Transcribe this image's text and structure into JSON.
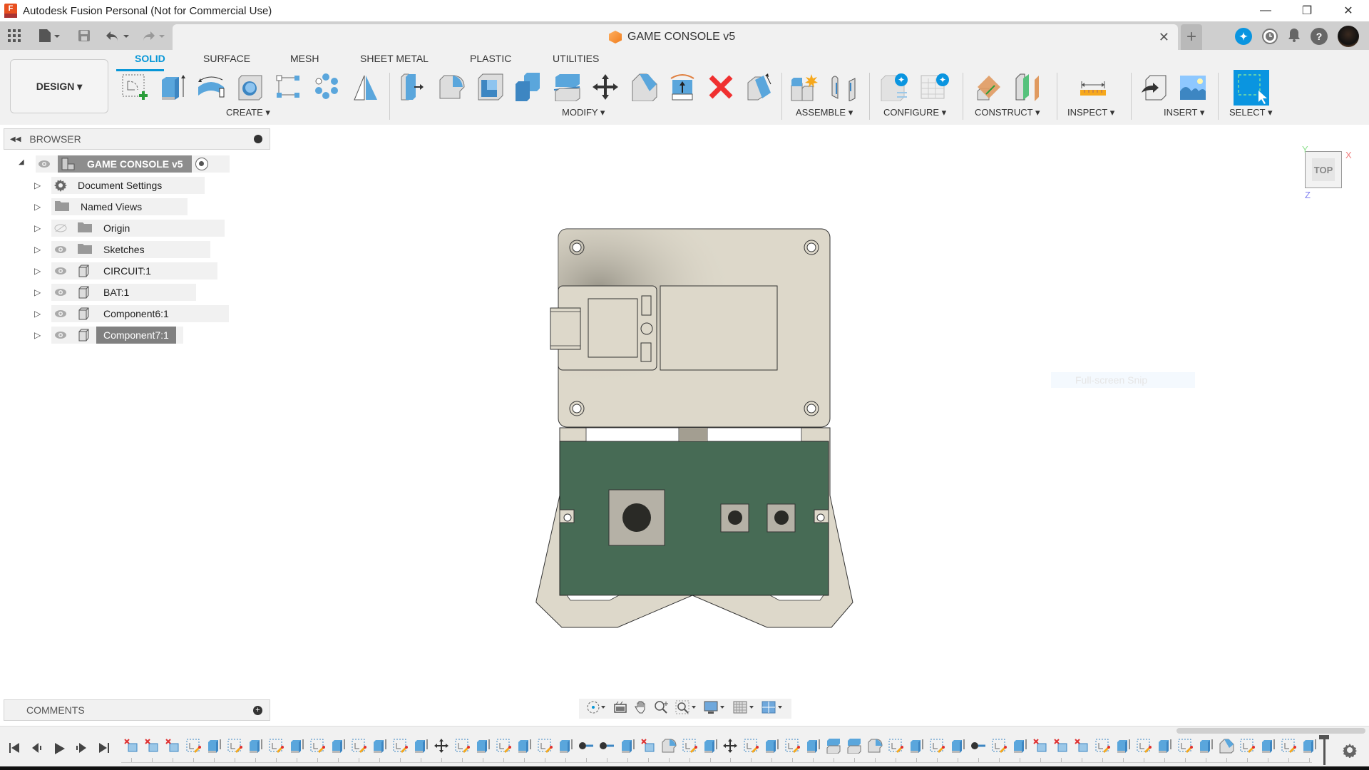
{
  "window": {
    "title": "Autodesk Fusion Personal (Not for Commercial Use)",
    "logo_letter": "F",
    "controls": {
      "minimize": "—",
      "maximize": "❐",
      "close": "✕"
    }
  },
  "quick_access": {
    "icons": [
      "app-grid-icon",
      "file-icon",
      "save-icon",
      "undo-icon",
      "redo-icon"
    ]
  },
  "document_tab": {
    "title": "GAME CONSOLE v5",
    "close": "✕",
    "new_tab": "+"
  },
  "top_right_icons": [
    "extensions-icon",
    "job-status-icon",
    "notifications-icon",
    "help-icon",
    "user-avatar"
  ],
  "workspace": {
    "label": "DESIGN ▾"
  },
  "ribbon": {
    "tabs": [
      {
        "label": "SOLID",
        "active": true
      },
      {
        "label": "SURFACE",
        "active": false
      },
      {
        "label": "MESH",
        "active": false
      },
      {
        "label": "SHEET METAL",
        "active": false
      },
      {
        "label": "PLASTIC",
        "active": false
      },
      {
        "label": "UTILITIES",
        "active": false
      }
    ],
    "groups": [
      {
        "label": "CREATE ▾",
        "tools": [
          "create-sketch",
          "extrude",
          "revolve",
          "hole",
          "rectangular-pattern",
          "circular-pattern",
          "mirror"
        ]
      },
      {
        "label": "MODIFY ▾",
        "tools": [
          "press-pull",
          "fillet",
          "shell",
          "combine",
          "split-body",
          "move-copy",
          "chamfer",
          "offset-face",
          "delete",
          "draft"
        ]
      },
      {
        "label": "ASSEMBLE ▾",
        "tools": [
          "new-component",
          "joint"
        ]
      },
      {
        "label": "CONFIGURE ▾",
        "tools": [
          "configure-design",
          "configuration-table"
        ]
      },
      {
        "label": "CONSTRUCT ▾",
        "tools": [
          "offset-plane",
          "midplane"
        ]
      },
      {
        "label": "INSPECT ▾",
        "tools": [
          "measure"
        ]
      },
      {
        "label": "INSERT ▾",
        "tools": [
          "insert-derive",
          "insert-canvas"
        ]
      },
      {
        "label": "SELECT ▾",
        "tools": [
          "window-select"
        ]
      }
    ]
  },
  "browser": {
    "header": "BROWSER",
    "root": {
      "label": "GAME CONSOLE v5"
    },
    "items": [
      {
        "label": "Document Settings",
        "icon": "gear-icon",
        "visible": null
      },
      {
        "label": "Named Views",
        "icon": "folder-icon",
        "visible": null
      },
      {
        "label": "Origin",
        "icon": "folder-icon",
        "visible": false
      },
      {
        "label": "Sketches",
        "icon": "folder-icon",
        "visible": true
      },
      {
        "label": "CIRCUIT:1",
        "icon": "component-icon",
        "visible": true
      },
      {
        "label": "BAT:1",
        "icon": "component-icon",
        "visible": true
      },
      {
        "label": "Component6:1",
        "icon": "component-icon",
        "visible": true
      },
      {
        "label": "Component7:1",
        "icon": "component-icon",
        "visible": true,
        "selected": true
      }
    ]
  },
  "viewcube": {
    "face": "TOP",
    "axis_x": "X",
    "axis_y": "Y",
    "axis_z": "Z"
  },
  "overlay": {
    "snip_text": "Full-screen Snip"
  },
  "comments": {
    "header": "COMMENTS"
  },
  "navigation_bar": {
    "tools": [
      "orbit",
      "look-at",
      "pan",
      "zoom",
      "fit",
      "display-settings",
      "grid-settings",
      "viewports"
    ]
  },
  "timeline": {
    "controls": [
      "go-to-start",
      "step-back",
      "play",
      "step-forward",
      "go-to-end"
    ],
    "features": [
      "remove",
      "remove",
      "remove",
      "sketch",
      "extrude",
      "sketch",
      "extrude",
      "sketch",
      "extrude",
      "sketch",
      "extrude",
      "sketch",
      "extrude",
      "sketch",
      "extrude",
      "move",
      "sketch",
      "extrude",
      "sketch",
      "extrude",
      "sketch",
      "extrude",
      "joint",
      "joint",
      "extrude",
      "remove",
      "fillet",
      "sketch",
      "extrude",
      "move",
      "sketch",
      "extrude",
      "sketch",
      "extrude",
      "split",
      "split",
      "fillet",
      "sketch",
      "extrude",
      "sketch",
      "extrude",
      "joint",
      "sketch",
      "extrude",
      "remove",
      "remove",
      "remove",
      "sketch",
      "extrude",
      "sketch",
      "extrude",
      "sketch",
      "extrude",
      "chamfer",
      "sketch",
      "extrude",
      "sketch",
      "extrude"
    ]
  },
  "colors": {
    "accent": "#0696d7",
    "case_body": "#ddd8ca",
    "pcb_green": "#476b55",
    "button_base": "#b5b1a6",
    "button_cap": "#2a2a26"
  }
}
